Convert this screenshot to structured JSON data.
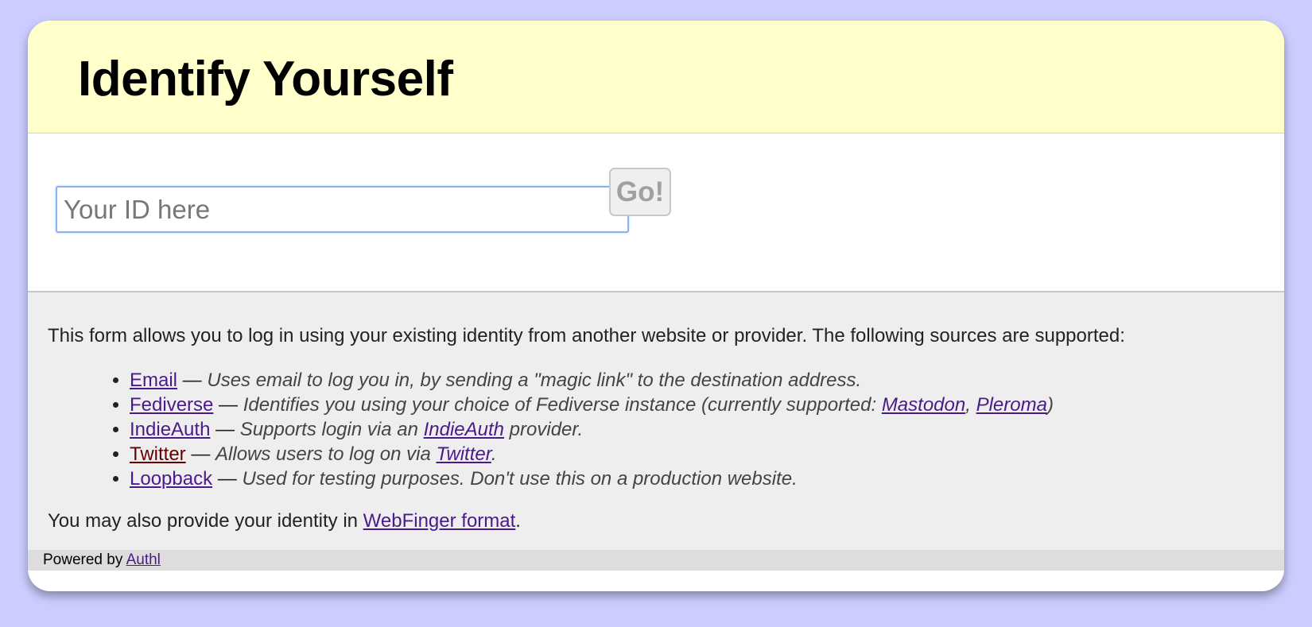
{
  "header": {
    "title": "Identify Yourself"
  },
  "form": {
    "input_placeholder": "Your ID here",
    "input_value": "",
    "go_label": "Go!"
  },
  "info": {
    "intro": "This form allows you to log in using your existing identity from another website or provider. The following sources are supported:",
    "sources": [
      {
        "name": "Email",
        "dash": " — ",
        "desc": "Uses email to log you in, by sending a \"magic link\" to the destination address."
      },
      {
        "name": "Fediverse",
        "dash": " — ",
        "desc_before": "Identifies you using your choice of Fediverse instance (currently supported: ",
        "link1": "Mastodon",
        "sep": ", ",
        "link2": "Pleroma",
        "desc_after": ")"
      },
      {
        "name": "IndieAuth",
        "dash": " — ",
        "desc_before": "Supports login via an ",
        "link1": "IndieAuth",
        "desc_after": " provider."
      },
      {
        "name": "Twitter",
        "dash": " — ",
        "desc_before": "Allows users to log on via ",
        "link1": "Twitter",
        "desc_after": "."
      },
      {
        "name": "Loopback",
        "dash": " — ",
        "desc": "Used for testing purposes. Don't use this on a production website."
      }
    ],
    "webfinger_before": "You may also provide your identity in ",
    "webfinger_link": "WebFinger format",
    "webfinger_after": "."
  },
  "footer": {
    "powered_by": "Powered by ",
    "link": "Authl"
  },
  "colors": {
    "page_background": "#ccccff",
    "header_background": "#ffffcc",
    "info_background": "#eeeeee",
    "footer_background": "#dddddd",
    "link": "#4b1a8a",
    "visited_link": "#660000",
    "input_focus_border": "#8ab4ef"
  }
}
